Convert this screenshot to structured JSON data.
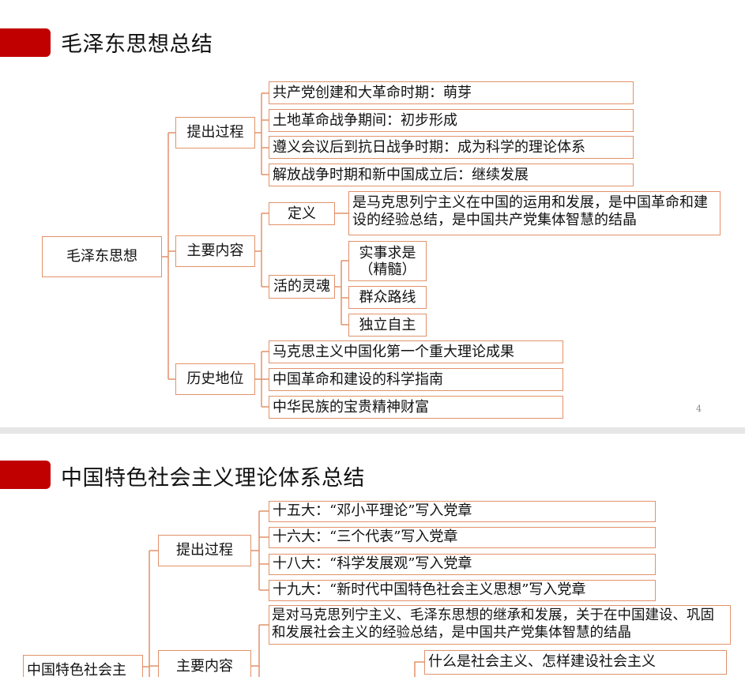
{
  "slide1": {
    "title": "毛泽东思想总结",
    "root": "毛泽东思想",
    "branch1": {
      "label": "提出过程",
      "items": [
        "共产党创建和大革命时期：萌芽",
        "土地革命战争期间：初步形成",
        "遵义会议后到抗日战争时期：成为科学的理论体系",
        "解放战争时期和新中国成立后：继续发展"
      ]
    },
    "branch2": {
      "label": "主要内容",
      "definition_label": "定义",
      "definition_text": "是马克思列宁主义在中国的运用和发展，是中国革命和建设的经验总结，是中国共产党集体智慧的结晶",
      "soul_label": "活的灵魂",
      "soul_items": [
        "实事求是（精髓）",
        "群众路线",
        "独立自主"
      ]
    },
    "branch3": {
      "label": "历史地位",
      "items": [
        "马克思主义中国化第一个重大理论成果",
        "中国革命和建设的科学指南",
        "中华民族的宝贵精神财富"
      ]
    },
    "page_number": "4"
  },
  "slide2": {
    "title": "中国特色社会主义理论体系总结",
    "root": "中国特色社会主",
    "branch1": {
      "label": "提出过程",
      "items": [
        "十五大：“邓小平理论”写入党章",
        "十六大：“三个代表”写入党章",
        "十八大：“科学发展观”写入党章",
        "十九大：“新时代中国特色社会主义思想”写入党章"
      ]
    },
    "branch2": {
      "label": "主要内容",
      "definition_text": "是对马克思列宁主义、毛泽东思想的继承和发展，关于在中国建设、巩固和发展社会主义的经验总结，是中国共产党集体智慧的结晶",
      "question_text": "什么是社会主义、怎样建设社会主义"
    }
  },
  "colors": {
    "accent": "#c00000",
    "box_border": "#e2926a"
  }
}
